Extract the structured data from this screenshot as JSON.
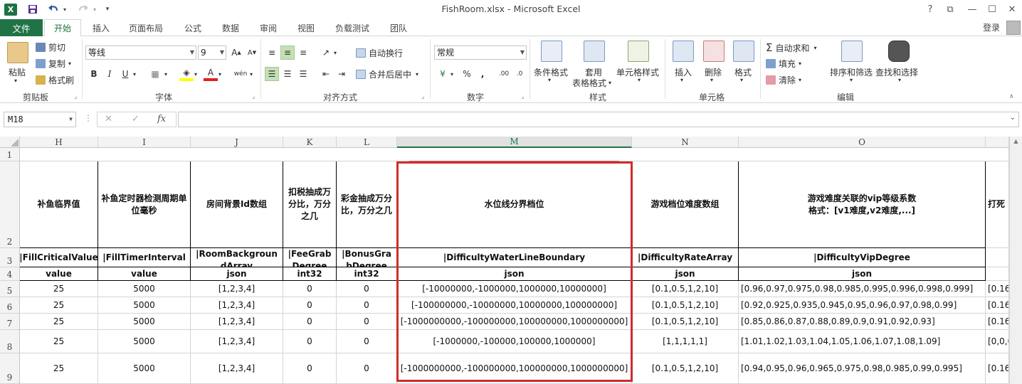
{
  "window": {
    "title": "FishRoom.xlsx - Microsoft Excel",
    "logo": "X",
    "controls": [
      "?",
      "⧉",
      "—",
      "☐",
      "✕"
    ]
  },
  "quick_access": {
    "save_icon": "save-icon",
    "undo_icon": "undo-icon",
    "redo_icon": "redo-icon"
  },
  "tabs": {
    "file": "文件",
    "items": [
      "开始",
      "插入",
      "页面布局",
      "公式",
      "数据",
      "审阅",
      "视图",
      "负载测试",
      "团队"
    ],
    "active": "开始",
    "login": "登录"
  },
  "ribbon": {
    "clipboard": {
      "label": "剪贴板",
      "paste": "粘贴",
      "cut": "剪切",
      "copy": "复制",
      "format_painter": "格式刷"
    },
    "font": {
      "label": "字体",
      "font_name": "等线",
      "font_size": "9"
    },
    "alignment": {
      "label": "对齐方式",
      "wrap_text": "自动换行",
      "merge_center": "合并后居中"
    },
    "number": {
      "label": "数字",
      "format": "常规"
    },
    "styles": {
      "label": "样式",
      "conditional": "条件格式",
      "table_line1": "套用",
      "table_line2": "表格格式",
      "cell_styles": "单元格样式"
    },
    "cells": {
      "label": "单元格",
      "insert": "插入",
      "delete": "删除",
      "format": "格式"
    },
    "editing": {
      "label": "编辑",
      "autosum": "自动求和",
      "fill": "填充",
      "clear": "清除",
      "sort_filter": "排序和筛选",
      "find_select": "查找和选择"
    }
  },
  "formula_bar": {
    "name_box": "M18",
    "fx": "fx",
    "formula": ""
  },
  "sheet": {
    "columns": [
      "H",
      "I",
      "J",
      "K",
      "L",
      "M",
      "N",
      "O"
    ],
    "active_column": "M",
    "rows": [
      "1",
      "2",
      "3",
      "4",
      "5",
      "6",
      "7",
      "8",
      "9"
    ],
    "header_desc": {
      "H": "补鱼临界值",
      "I": "补鱼定时器检测周期单位毫秒",
      "J": "房间背景Id数组",
      "K": "扣税抽成万分比，万分之几",
      "L": "彩金抽成万分比，万分之几",
      "M": "水位线分界档位",
      "N": "游戏档位难度数组",
      "O_line1": "游戏难度关联的vip等级系数",
      "O_line2": "格式：[v1难度,v2难度,...]",
      "P": "打死"
    },
    "field_names": {
      "H": "|FillCriticalValue",
      "I": "|FillTimerInterval",
      "J": "|RoomBackgroundArray",
      "K": "|FeeGrabDegree",
      "L": "|BonusGrabDegree",
      "M": "|DifficultyWaterLineBoundary",
      "N": "|DifficultyRateArray",
      "O": "|DifficultyVipDegree"
    },
    "types": {
      "H": "value",
      "I": "value",
      "J": "json",
      "K": "int32",
      "L": "int32",
      "M": "json",
      "N": "json",
      "O": "json"
    },
    "data_rows": [
      {
        "H": "25",
        "I": "5000",
        "J": "[1,2,3,4]",
        "K": "0",
        "L": "0",
        "M": "[-10000000,-1000000,1000000,10000000]",
        "N": "[0.1,0.5,1,2,10]",
        "O": "[0.96,0.97,0.975,0.98,0.985,0.995,0.996,0.998,0.999]",
        "P": "[0.16"
      },
      {
        "H": "25",
        "I": "5000",
        "J": "[1,2,3,4]",
        "K": "0",
        "L": "0",
        "M": "[-100000000,-10000000,10000000,100000000]",
        "N": "[0.1,0.5,1,2,10]",
        "O": "[0.92,0.925,0.935,0.945,0.95,0.96,0.97,0.98,0.99]",
        "P": "[0.16"
      },
      {
        "H": "25",
        "I": "5000",
        "J": "[1,2,3,4]",
        "K": "0",
        "L": "0",
        "M": "[-1000000000,-100000000,100000000,1000000000]",
        "N": "[0.1,0.5,1,2,10]",
        "O": "[0.85,0.86,0.87,0.88,0.89,0.9,0.91,0.92,0.93]",
        "P": "[0.16"
      },
      {
        "H": "25",
        "I": "5000",
        "J": "[1,2,3,4]",
        "K": "0",
        "L": "0",
        "M": "[-1000000,-100000,100000,1000000]",
        "N": "[1,1,1,1,1]",
        "O": "[1.01,1.02,1.03,1.04,1.05,1.06,1.07,1.08,1.09]",
        "P": "[0,0,0"
      },
      {
        "H": "25",
        "I": "5000",
        "J": "[1,2,3,4]",
        "K": "0",
        "L": "0",
        "M": "[-1000000000,-100000000,100000000,1000000000]",
        "N": "[0.1,0.5,1,2,10]",
        "O": "[0.94,0.95,0.96,0.965,0.975,0.98,0.985,0.99,0.995]",
        "P": "[0.16"
      }
    ]
  },
  "colors": {
    "excel_green": "#217346",
    "highlight_red": "#d22b2b"
  }
}
